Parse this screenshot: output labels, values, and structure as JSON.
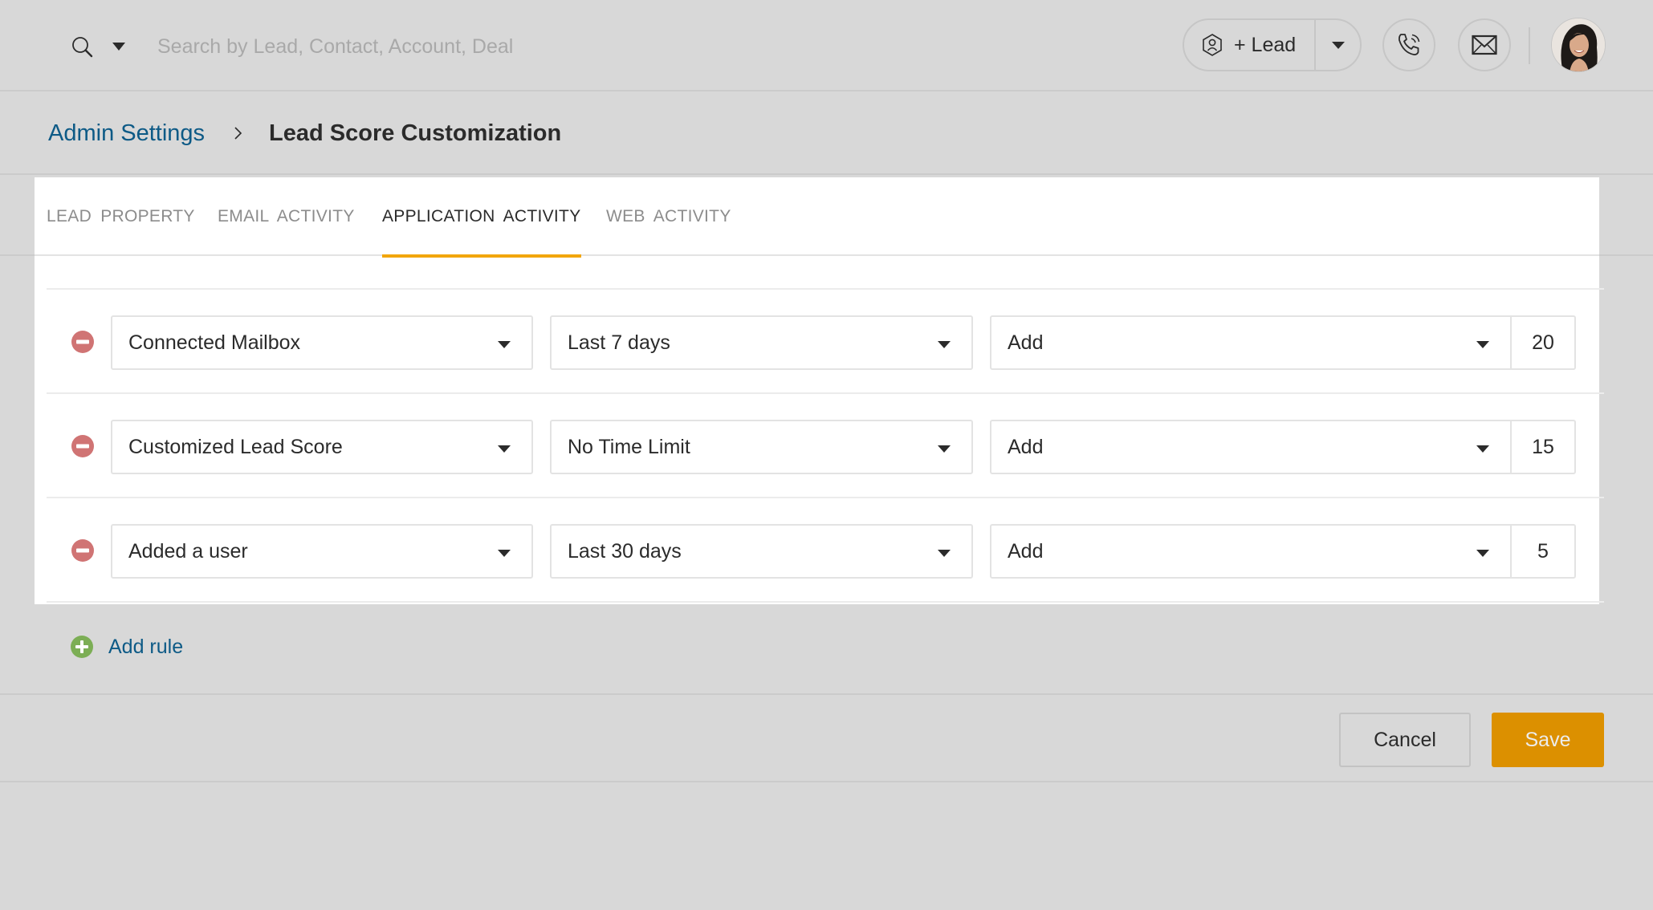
{
  "header": {
    "search_placeholder": "Search by Lead, Contact, Account, Deal",
    "search_value": "",
    "add_lead_label": "+ Lead",
    "icons": {
      "search": "search-icon",
      "lead": "lead-user-icon",
      "phone": "phone-icon",
      "mail": "mail-icon",
      "avatar": "user-avatar"
    }
  },
  "breadcrumb": {
    "parent": "Admin Settings",
    "current": "Lead Score Customization"
  },
  "tabs": [
    {
      "label": "LEAD PROPERTY",
      "active": false
    },
    {
      "label": "EMAIL ACTIVITY",
      "active": false
    },
    {
      "label": "APPLICATION ACTIVITY",
      "active": true
    },
    {
      "label": "WEB ACTIVITY",
      "active": false
    }
  ],
  "rules": [
    {
      "activity": "Connected Mailbox",
      "time_range": "Last 7 days",
      "operation": "Add",
      "points": "20"
    },
    {
      "activity": "Customized Lead Score",
      "time_range": "No Time Limit",
      "operation": "Add",
      "points": "15"
    },
    {
      "activity": "Added a user",
      "time_range": "Last 30 days",
      "operation": "Add",
      "points": "5"
    }
  ],
  "add_rule_label": "Add rule",
  "footer": {
    "cancel_label": "Cancel",
    "save_label": "Save"
  },
  "colors": {
    "accent_tab": "#f2a60c",
    "save_button": "#dc9000",
    "link": "#0d5a86",
    "remove_icon": "#d07474",
    "add_icon": "#7cae55"
  }
}
